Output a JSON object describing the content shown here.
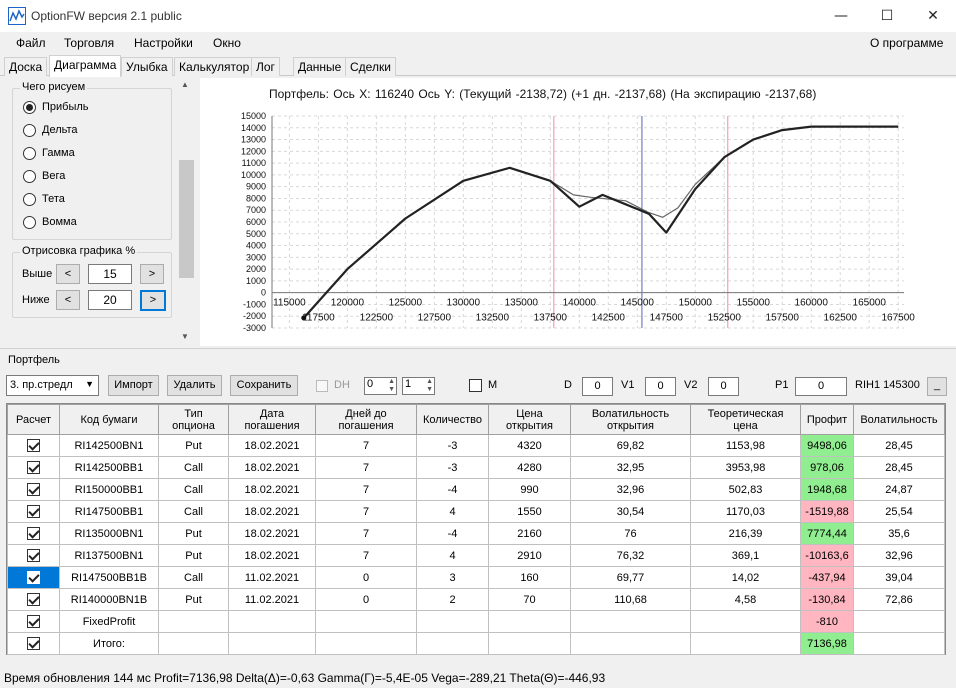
{
  "window": {
    "title": "OptionFW версия 2.1 public",
    "minimize": "—",
    "maximize": "☐",
    "close": "✕"
  },
  "menu": {
    "items": [
      "Файл",
      "Торговля",
      "Настройки",
      "Окно"
    ],
    "about": "О программе"
  },
  "tabs": [
    "Доска",
    "Диаграмма",
    "Улыбка",
    "Калькулятор",
    "Лог",
    "Данные",
    "Сделки"
  ],
  "active_tab": "Диаграмма",
  "left_panel": {
    "what_title": "Чего рисуем",
    "options": [
      "Прибыль",
      "Дельта",
      "Гамма",
      "Вега",
      "Тета",
      "Вомма"
    ],
    "selected": "Прибыль",
    "draw_title": "Отрисовка графика %",
    "above_label": "Выше",
    "above_value": "15",
    "below_label": "Ниже",
    "below_value": "20",
    "dec": "<",
    "inc": ">"
  },
  "chart_title": "Портфель:  Ось X:  116240  Ось Y:   (Текущий -2138,72)   (+1 дн. -2137,68)   (На экспирацию -2137,68)",
  "chart_data": {
    "type": "line",
    "x_ticks_upper": [
      115000,
      120000,
      125000,
      130000,
      135000,
      140000,
      145000,
      150000,
      155000,
      160000,
      165000
    ],
    "x_ticks_lower": [
      117500,
      122500,
      127500,
      132500,
      137500,
      142500,
      147500,
      152500,
      157500,
      162500,
      167500
    ],
    "y_ticks": [
      15000,
      14000,
      13000,
      12000,
      11000,
      10000,
      9000,
      8000,
      7000,
      6000,
      5000,
      4000,
      3000,
      2000,
      1000,
      0,
      -1000,
      -2000,
      -3000
    ],
    "xlim": [
      113500,
      168000
    ],
    "ylim": [
      -3000,
      15000
    ],
    "grid": true,
    "vertical_lines": [
      {
        "x": 137800,
        "color": "#f4a0b0"
      },
      {
        "x": 145400,
        "color": "#7080c0"
      },
      {
        "x": 152800,
        "color": "#f4a0b0"
      }
    ],
    "series": [
      {
        "values": [
          [
            116240,
            -2140
          ],
          [
            120000,
            2000
          ],
          [
            125000,
            6300
          ],
          [
            130000,
            9500
          ],
          [
            134000,
            10600
          ],
          [
            137500,
            9500
          ],
          [
            139500,
            8300
          ],
          [
            141000,
            8100
          ],
          [
            144000,
            7800
          ],
          [
            146000,
            6800
          ],
          [
            147200,
            6400
          ],
          [
            148500,
            7200
          ],
          [
            150000,
            9200
          ],
          [
            152500,
            11500
          ],
          [
            155000,
            13000
          ],
          [
            157500,
            13800
          ],
          [
            160000,
            14100
          ],
          [
            162500,
            14100
          ],
          [
            165000,
            14100
          ],
          [
            167500,
            14100
          ]
        ]
      },
      {
        "values": [
          [
            116240,
            -2140
          ],
          [
            120000,
            2000
          ],
          [
            125000,
            6300
          ],
          [
            130000,
            9500
          ],
          [
            134000,
            10600
          ],
          [
            137500,
            9500
          ],
          [
            140000,
            7300
          ],
          [
            142000,
            8300
          ],
          [
            144000,
            7500
          ],
          [
            146000,
            6700
          ],
          [
            147500,
            5100
          ],
          [
            150000,
            8800
          ],
          [
            152500,
            11500
          ],
          [
            155000,
            13000
          ],
          [
            157500,
            13800
          ],
          [
            160000,
            14100
          ],
          [
            162500,
            14100
          ],
          [
            165000,
            14100
          ],
          [
            167500,
            14100
          ]
        ]
      }
    ]
  },
  "portfolio": {
    "label": "Портфель",
    "select": "3. пр.стредл",
    "import": "Импорт",
    "delete": "Удалить",
    "save": "Сохранить",
    "dh": "DH",
    "spin1": "0",
    "spin2": "1",
    "m": "M",
    "d_label": "D",
    "d_value": "0",
    "v1_label": "V1",
    "v1_value": "0",
    "v2_label": "V2",
    "v2_value": "0",
    "p1_label": "P1",
    "p1_value": "0",
    "ticker": "RIH1 145300",
    "more": "_"
  },
  "table": {
    "headers": [
      "Расчет",
      "Код бумаги",
      "Тип\nопциона",
      "Дата\nпогашения",
      "Дней до\nпогашения",
      "Количество",
      "Цена\nоткрытия",
      "Волатильность\nоткрытия",
      "Теоретическая\nцена",
      "Профит",
      "Волатильность"
    ],
    "rows": [
      {
        "check": true,
        "code": "RI142500BN1",
        "type": "Put",
        "date": "18.02.2021",
        "days": "7",
        "qty": "-3",
        "price": "4320",
        "vol_open": "69,82",
        "theor": "1153,98",
        "profit": "9498,06",
        "pclass": "pos",
        "vol": "28,45"
      },
      {
        "check": true,
        "code": "RI142500BB1",
        "type": "Call",
        "date": "18.02.2021",
        "days": "7",
        "qty": "-3",
        "price": "4280",
        "vol_open": "32,95",
        "theor": "3953,98",
        "profit": "978,06",
        "pclass": "pos",
        "vol": "28,45"
      },
      {
        "check": true,
        "code": "RI150000BB1",
        "type": "Call",
        "date": "18.02.2021",
        "days": "7",
        "qty": "-4",
        "price": "990",
        "vol_open": "32,96",
        "theor": "502,83",
        "profit": "1948,68",
        "pclass": "pos",
        "vol": "24,87"
      },
      {
        "check": true,
        "code": "RI147500BB1",
        "type": "Call",
        "date": "18.02.2021",
        "days": "7",
        "qty": "4",
        "price": "1550",
        "vol_open": "30,54",
        "theor": "1170,03",
        "profit": "-1519,88",
        "pclass": "neg",
        "vol": "25,54"
      },
      {
        "check": true,
        "code": "RI135000BN1",
        "type": "Put",
        "date": "18.02.2021",
        "days": "7",
        "qty": "-4",
        "price": "2160",
        "vol_open": "76",
        "theor": "216,39",
        "profit": "7774,44",
        "pclass": "pos",
        "vol": "35,6"
      },
      {
        "check": true,
        "code": "RI137500BN1",
        "type": "Put",
        "date": "18.02.2021",
        "days": "7",
        "qty": "4",
        "price": "2910",
        "vol_open": "76,32",
        "theor": "369,1",
        "profit": "-10163,6",
        "pclass": "neg",
        "vol": "32,96"
      },
      {
        "check": true,
        "sel": true,
        "code": "RI147500BB1B",
        "type": "Call",
        "date": "11.02.2021",
        "days": "0",
        "qty": "3",
        "price": "160",
        "vol_open": "69,77",
        "theor": "14,02",
        "profit": "-437,94",
        "pclass": "neg",
        "vol": "39,04"
      },
      {
        "check": true,
        "code": "RI140000BN1B",
        "type": "Put",
        "date": "11.02.2021",
        "days": "0",
        "qty": "2",
        "price": "70",
        "vol_open": "110,68",
        "theor": "4,58",
        "profit": "-130,84",
        "pclass": "neg",
        "vol": "72,86"
      },
      {
        "check": true,
        "code": "FixedProfit",
        "type": "",
        "date": "",
        "days": "",
        "qty": "",
        "price": "",
        "vol_open": "",
        "theor": "",
        "profit": "-810",
        "pclass": "neg",
        "vol": ""
      },
      {
        "check": true,
        "code": "Итого:",
        "type": "",
        "date": "",
        "days": "",
        "qty": "",
        "price": "",
        "vol_open": "",
        "theor": "",
        "profit": "7136,98",
        "pclass": "pos",
        "vol": ""
      }
    ]
  },
  "status": "Время обновления 144 мс  Profit=7136,98 Delta(Δ)=-0,63 Gamma(Γ)=-5,4E-05 Vega=-289,21 Theta(Θ)=-446,93"
}
